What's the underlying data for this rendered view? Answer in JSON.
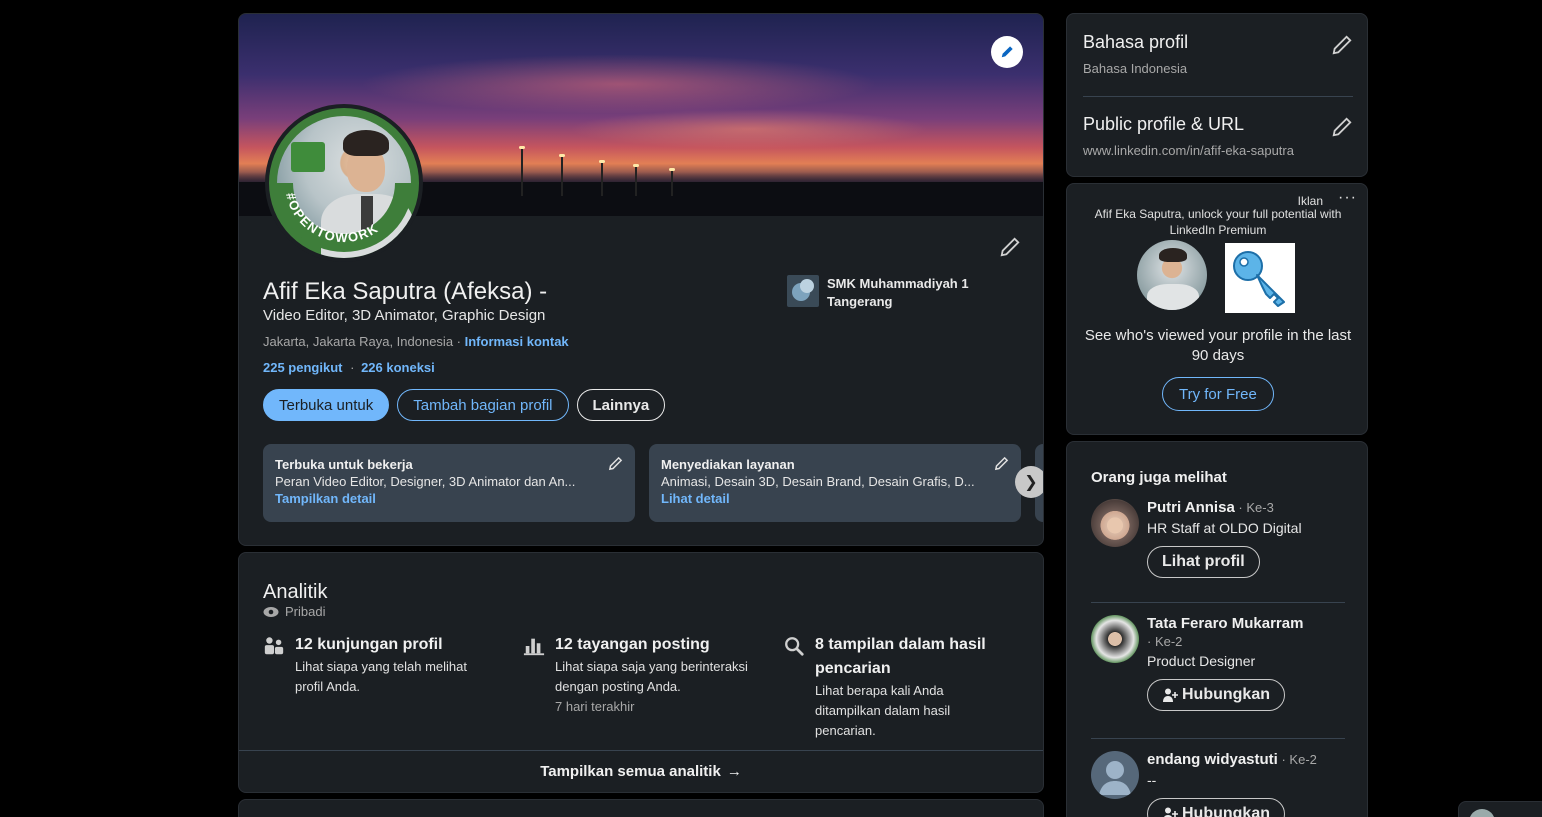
{
  "profile": {
    "name": "Afif Eka Saputra (Afeksa) -",
    "headline": "Video Editor, 3D Animator, Graphic Design",
    "location": "Jakarta, Jakarta Raya, Indonesia ·",
    "contact_link": "Informasi kontak",
    "followers": "225 pengikut",
    "stats_sep": "·",
    "connections": "226 koneksi",
    "otw_badge": "#OPENTOWORK",
    "school": "SMK Muhammadiyah 1 Tangerang",
    "buttons": {
      "open_to": "Terbuka untuk",
      "add_section": "Tambah bagian profil",
      "more": "Lainnya"
    },
    "cards": [
      {
        "title": "Terbuka untuk bekerja",
        "desc": "Peran Video Editor, Designer, 3D Animator dan An...",
        "link": "Tampilkan detail"
      },
      {
        "title": "Menyediakan layanan",
        "desc": "Animasi, Desain 3D, Desain Brand, Desain Grafis, D...",
        "link": "Lihat detail"
      }
    ],
    "next_glyph": "❯"
  },
  "analytics": {
    "title": "Analitik",
    "privacy": "Pribadi",
    "items": [
      {
        "icon": "people-icon",
        "headline": "12 kunjungan profil",
        "sub": "Lihat siapa yang telah melihat profil Anda.",
        "meta": ""
      },
      {
        "icon": "bar-chart-icon",
        "headline": "12 tayangan posting",
        "sub": "Lihat siapa saja yang berinteraksi dengan posting Anda.",
        "meta": "7 hari terakhir"
      },
      {
        "icon": "search-icon",
        "headline": "8 tampilan dalam hasil pencarian",
        "sub": "Lihat berapa kali Anda ditampilkan dalam hasil pencarian.",
        "meta": ""
      }
    ],
    "footer": "Tampilkan semua analitik",
    "footer_arrow": "→"
  },
  "settings": {
    "language_title": "Bahasa profil",
    "language_value": "Bahasa Indonesia",
    "url_title": "Public profile & URL",
    "url_value": "www.linkedin.com/in/afif-eka-saputra"
  },
  "ad": {
    "label": "Iklan",
    "more": "···",
    "text": "Afif Eka Saputra, unlock your full potential with LinkedIn Premium",
    "desc": "See who's viewed your profile in the last 90 days",
    "button": "Try for Free"
  },
  "pymk": {
    "title": "Orang juga melihat",
    "people": [
      {
        "name": "Putri Annisa",
        "degree": " · Ke-3",
        "headline": "HR Staff at OLDO Digital",
        "action": "Lihat profil"
      },
      {
        "name": "Tata Feraro Mukarram",
        "degree": "· Ke-2",
        "headline": "Product Designer",
        "action": "Hubungkan"
      },
      {
        "name": "endang widyastuti",
        "degree": " · Ke-2",
        "headline": "--",
        "action": "Hubungkan"
      }
    ]
  },
  "colors": {
    "accent": "#71b7fb",
    "card": "#1b1f23",
    "inner_card": "#38434f",
    "otw_green": "#3e7e3a"
  }
}
